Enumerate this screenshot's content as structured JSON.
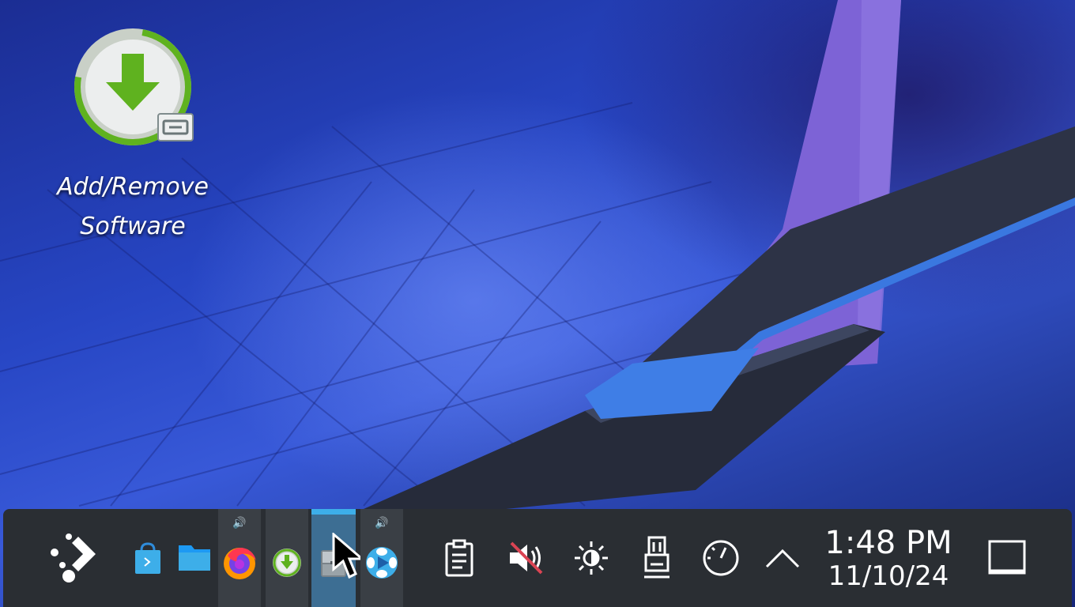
{
  "desktop": {
    "icons": [
      {
        "label_line1": "Add/Remove",
        "label_line2": "Software",
        "icon": "discover-download-icon"
      }
    ]
  },
  "taskbar": {
    "launcher_icon": "kde-launcher-icon",
    "pinned": [
      {
        "name": "store-icon"
      },
      {
        "name": "folder-icon"
      }
    ],
    "tasks": [
      {
        "name": "firefox-icon",
        "audio": true
      },
      {
        "name": "discover-icon",
        "audio": false
      },
      {
        "name": "file-manager-icon",
        "active": true
      },
      {
        "name": "media-player-icon",
        "audio": true
      }
    ],
    "tray": [
      {
        "name": "clipboard-icon"
      },
      {
        "name": "volume-muted-icon"
      },
      {
        "name": "brightness-icon"
      },
      {
        "name": "usb-device-icon"
      },
      {
        "name": "performance-gauge-icon"
      },
      {
        "name": "chevron-up-icon"
      }
    ],
    "clock": {
      "time": "1:48 PM",
      "date": "11/10/24"
    },
    "show_desktop_icon": "show-desktop-icon"
  },
  "colors": {
    "accent": "#3daee9",
    "panel": "#2a2e33",
    "discover_green": "#5fb21f"
  }
}
